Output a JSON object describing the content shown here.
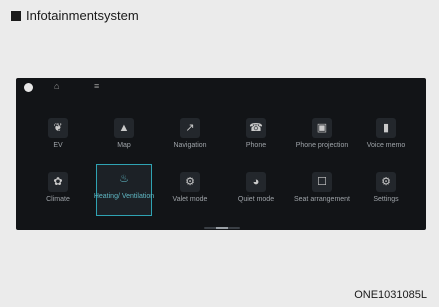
{
  "header": {
    "title": "Infotainmentsystem"
  },
  "topbar": {
    "home_icon": "home-icon",
    "menu_icon": "menu-icon"
  },
  "tiles_row1": [
    {
      "label": "EV",
      "icon": "leaf-icon",
      "glyph": "❦"
    },
    {
      "label": "Map",
      "icon": "arrow-icon",
      "glyph": "▲"
    },
    {
      "label": "Navigation",
      "icon": "compass-icon",
      "glyph": "↗"
    },
    {
      "label": "Phone",
      "icon": "phone-icon",
      "glyph": "☎"
    },
    {
      "label": "Phone projection",
      "icon": "projection-icon",
      "glyph": "▣"
    },
    {
      "label": "Voice memo",
      "icon": "voice-memo-icon",
      "glyph": "▮"
    }
  ],
  "tiles_row2": [
    {
      "label": "Climate",
      "icon": "fan-icon",
      "glyph": "✿"
    },
    {
      "label": "Heating/ Ventilation",
      "icon": "seat-heating-icon",
      "glyph": "♨",
      "selected": true
    },
    {
      "label": "Valet mode",
      "icon": "valet-icon",
      "glyph": "⚙"
    },
    {
      "label": "Quiet mode",
      "icon": "quiet-icon",
      "glyph": "◕"
    },
    {
      "label": "Seat arrangement",
      "icon": "seat-icon",
      "glyph": "☐"
    },
    {
      "label": "Settings",
      "icon": "gear-icon",
      "glyph": "⚙"
    }
  ],
  "caption": "ONE1031085L",
  "colors": {
    "screen_bg": "#121417",
    "accent": "#2fa3b3"
  }
}
